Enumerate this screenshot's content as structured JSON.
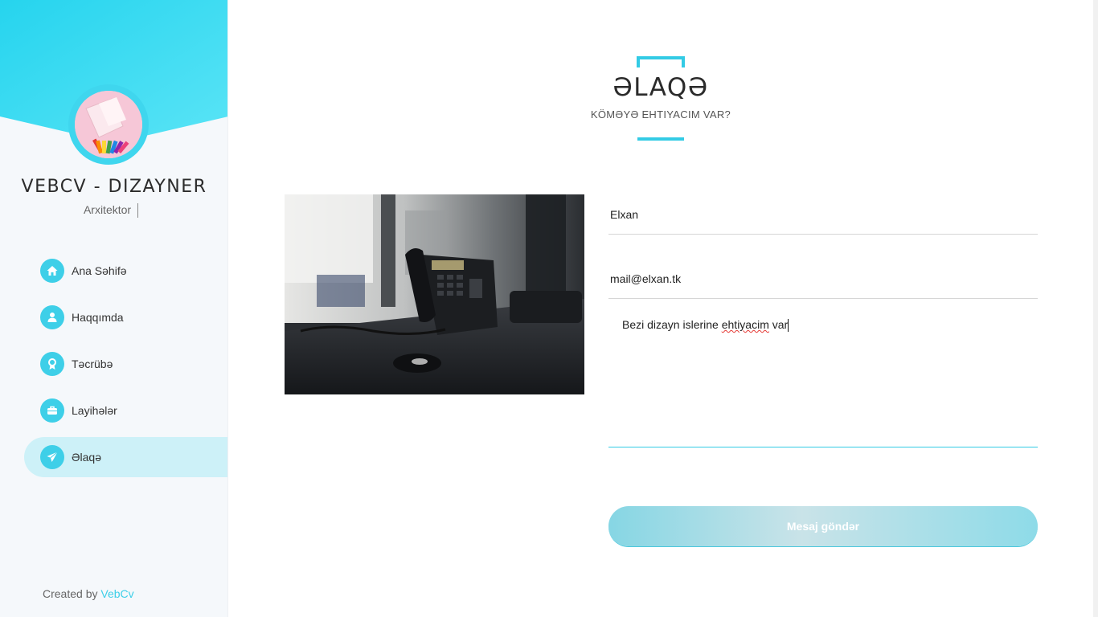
{
  "colors": {
    "accent": "#33cbe5",
    "active_nav_bg": "#cdf1f8",
    "sidebar_bg": "#f5f8fb"
  },
  "sidebar": {
    "brand_title": "VEBCV - DIZAYNER",
    "brand_subtitle": "Arxitektor",
    "nav": [
      {
        "label": "Ana Səhifə",
        "icon": "home-icon",
        "active": false
      },
      {
        "label": "Haqqımda",
        "icon": "user-icon",
        "active": false
      },
      {
        "label": "Təcrübə",
        "icon": "award-icon",
        "active": false
      },
      {
        "label": "Layihələr",
        "icon": "briefcase-icon",
        "active": false
      },
      {
        "label": "Əlaqə",
        "icon": "paper-plane-icon",
        "active": true
      }
    ],
    "footer": {
      "prefix": "Created by ",
      "link": "VebCv"
    }
  },
  "main": {
    "heading": {
      "title": "ƏLAQƏ",
      "subtitle": "KÖMƏYƏ EHTIYACIM VAR?"
    },
    "form": {
      "name_value": "Elxan",
      "email_value": "mail@elxan.tk",
      "message_part1": "Bezi dizayn islerine ",
      "message_misspelled": "ehtiyacim",
      "message_part2": " var",
      "send_label": "Mesaj göndər"
    }
  }
}
